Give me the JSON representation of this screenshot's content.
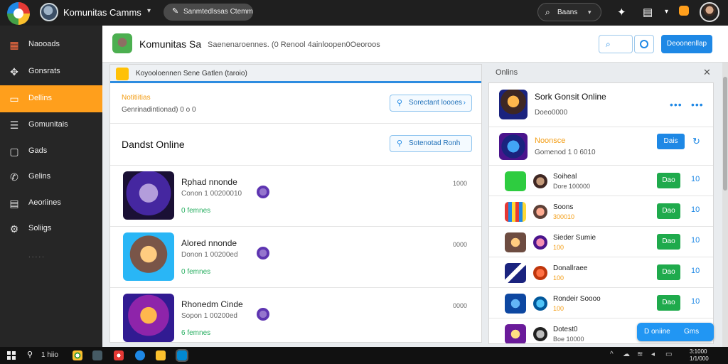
{
  "topbar": {
    "title": "Komunitas Camms",
    "pill_label": "Sanmtedlssas Ctemm",
    "search_label": "Baans"
  },
  "sidebar": {
    "items": [
      {
        "label": "Naooads",
        "icon": "grid-icon"
      },
      {
        "label": "Gonsrats",
        "icon": "gamepad-icon"
      },
      {
        "label": "Dellins",
        "icon": "chat-icon",
        "active": true
      },
      {
        "label": "Gomunitais",
        "icon": "list-icon"
      },
      {
        "label": "Gads",
        "icon": "card-icon"
      },
      {
        "label": "Gelins",
        "icon": "phone-icon"
      },
      {
        "label": "Aeoriines",
        "icon": "news-icon"
      },
      {
        "label": "Soliigs",
        "icon": "settings-icon"
      }
    ],
    "more": "....."
  },
  "header": {
    "title": "Komunitas Sa",
    "subtitle": "Saenenaroennes.  (0 Renool 4ainloopen0Oeoroos",
    "button_label": "Deoonenllap"
  },
  "left_panel": {
    "bar_label": "Koyooloennen Sene Gatlen (taroio)",
    "notification": {
      "title": "Notitiitias",
      "subtitle": "Genrinadintionad) 0 o 0",
      "button_label": "Sorectant loooes"
    },
    "section_title": "Dandst Online",
    "section_button": "Sotenotad Ronh",
    "games": [
      {
        "name": "Rphad nnonde",
        "meta": "Conon 1 00200010",
        "status": "0 femnes",
        "count": "1000"
      },
      {
        "name": "Alored nnonde",
        "meta": "Donon 1 00200ed",
        "status": "0 femnes",
        "count": "0000"
      },
      {
        "name": "Rhonedm Cinde",
        "meta": "Sopon 1 00200ed",
        "status": "6 femnes",
        "count": "0000"
      }
    ]
  },
  "right_panel": {
    "title": "Onlins",
    "featured": {
      "name": "Sork Gonsit Online",
      "meta": "Doeo0000"
    },
    "now_playing": {
      "name": "Noonsce",
      "meta": "Gomenod 1 0 6010",
      "button_label": "Dais"
    },
    "friends": [
      {
        "name": "Soiheal",
        "meta": "Dore 100000",
        "orange": false,
        "button": "Dao",
        "icon_label": "10"
      },
      {
        "name": "Soons",
        "meta": "300010",
        "orange": true,
        "button": "Dao",
        "icon_label": "10"
      },
      {
        "name": "Sieder Sumie",
        "meta": "100",
        "orange": true,
        "button": "Dao",
        "icon_label": "10"
      },
      {
        "name": "Donallraee",
        "meta": "100",
        "orange": true,
        "button": "Dao",
        "icon_label": "10"
      },
      {
        "name": "Rondeir Soooo",
        "meta": "100",
        "orange": true,
        "button": "Dao",
        "icon_label": "10"
      },
      {
        "name": "Dotest0",
        "meta": "Boe 10000",
        "orange": false,
        "button": "",
        "icon_label": ""
      }
    ]
  },
  "float_button": {
    "a": "D oniine",
    "b": "Gms"
  },
  "taskbar": {
    "search_label": "1 hiio",
    "time": "3:1000",
    "date": "1/1/000"
  },
  "colors": {
    "accent_orange": "#ff9f1c",
    "accent_blue": "#1e88e5",
    "accent_green": "#1faa4c",
    "dark_bg": "#262626"
  }
}
